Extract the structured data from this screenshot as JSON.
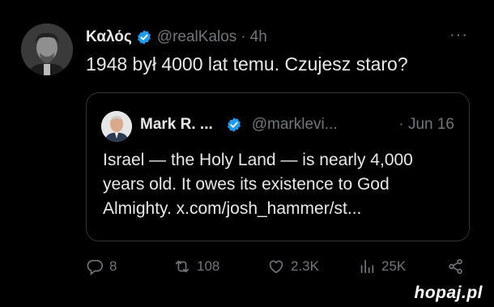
{
  "tweet": {
    "author_name": "Καλός",
    "handle": "@realKalos",
    "separator": "·",
    "time": "4h",
    "more": "···",
    "text": "1948 był 4000 lat temu. Czujesz staro?"
  },
  "quote": {
    "author_name": "Mark R. ...",
    "handle": "@marklevi...",
    "time": "· Jun 16",
    "text": "Israel — the Holy Land — is nearly 4,000 years old. It owes its existence to God Almighty. x.com/josh_hammer/st..."
  },
  "actions": {
    "replies": "8",
    "reposts": "108",
    "likes": "2.3K",
    "views": "25K"
  },
  "colors": {
    "background": "#000000",
    "text": "#e7e9ea",
    "muted": "#71767b",
    "verified": "#1d9bf0",
    "border": "#2f3336"
  },
  "icons": [
    "verified-badge-icon",
    "more-icon",
    "reply-icon",
    "repost-icon",
    "like-icon",
    "views-icon",
    "share-icon"
  ],
  "watermark": "hopaj.pl"
}
